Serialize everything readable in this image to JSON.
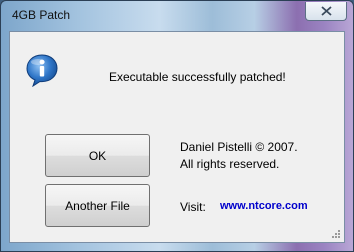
{
  "window": {
    "title": "4GB Patch"
  },
  "dialog": {
    "icon": "info-icon",
    "message": "Executable successfully patched!",
    "buttons": {
      "ok_label": "OK",
      "another_file_label": "Another File"
    },
    "copyright_line1": "Daniel Pistelli © 2007.",
    "copyright_line2": "All rights reserved.",
    "visit_label": "Visit:",
    "visit_link": "www.ntcore.com"
  },
  "colors": {
    "link": "#0000cc",
    "info_icon": "#1f63b8"
  }
}
